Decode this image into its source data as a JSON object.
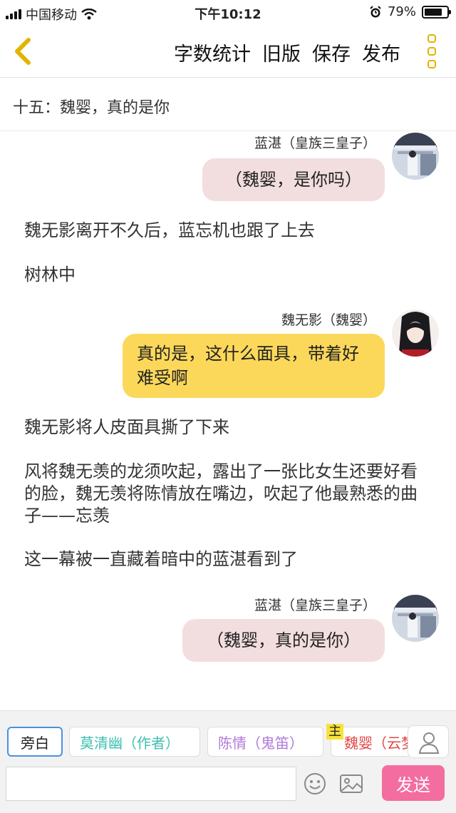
{
  "status": {
    "carrier": "中国移动",
    "time": "下午10:12",
    "battery": "79%",
    "battery_level": 0.79
  },
  "header": {
    "actions": [
      "字数统计",
      "旧版",
      "保存",
      "发布"
    ]
  },
  "chapter_title": "十五：魏婴，真的是你",
  "messages": [
    {
      "name": "蓝湛（皇族三皇子）",
      "text": "（魏婴，是你吗）"
    },
    {
      "narration": "魏无影离开不久后，蓝忘机也跟了上去"
    },
    {
      "narration": "树林中"
    },
    {
      "name": "魏无影（魏婴）",
      "text": "真的是，这什么面具，带着好难受啊"
    },
    {
      "narration": "魏无影将人皮面具撕了下来"
    },
    {
      "narration": "风将魏无羡的龙须吹起，露出了一张比女生还要好看的脸，魏无羡将陈情放在嘴边，吹起了他最熟悉的曲子——忘羡"
    },
    {
      "narration": "这一幕被一直藏着暗中的蓝湛看到了"
    },
    {
      "name": "蓝湛（皇族三皇子）",
      "text": "（魏婴，真的是你）"
    }
  ],
  "roles": [
    {
      "label": "旁白",
      "color": "#222222"
    },
    {
      "label": "莫清幽（作者）",
      "color": "#3cbfb0"
    },
    {
      "label": "陈情（鬼笛）",
      "color": "#b07ad8"
    },
    {
      "label": "魏婴（云梦",
      "color": "#e04848",
      "badge": "主"
    }
  ],
  "input": {
    "value": "",
    "placeholder": ""
  },
  "send_label": "发送",
  "colors": {
    "accent_yellow": "#fcd85a",
    "bubble_pink": "#f3dedf",
    "send_pink": "#f36da0",
    "icon_gold": "#e2b400"
  },
  "icons": [
    "back-icon",
    "more-icon",
    "wifi-icon",
    "alarm-icon",
    "battery-icon",
    "user-icon",
    "emoji-icon",
    "image-icon"
  ]
}
